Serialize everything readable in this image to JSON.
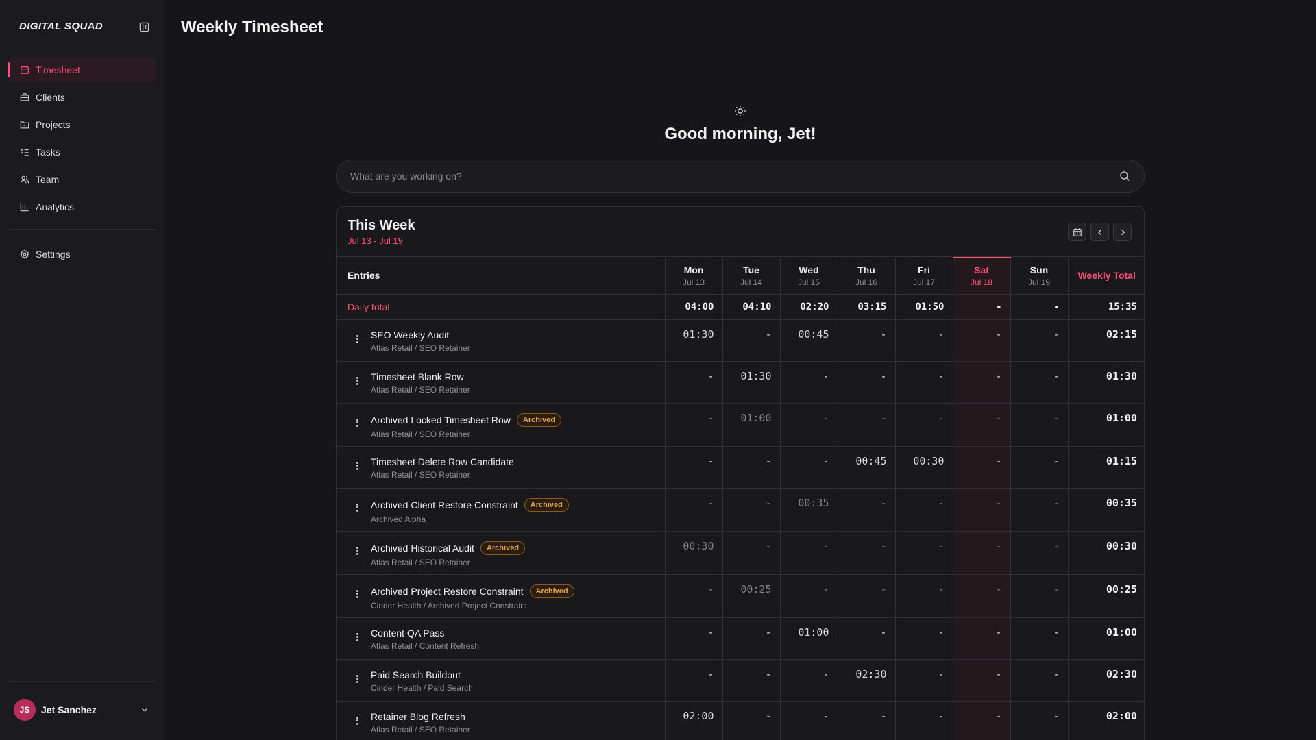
{
  "app": {
    "brand": "DIGITAL SQUAD",
    "page_title": "Weekly Timesheet",
    "accent_color": "#ff4f7a"
  },
  "sidebar": {
    "items": [
      {
        "label": "Timesheet",
        "icon": "calendar-icon",
        "active": true
      },
      {
        "label": "Clients",
        "icon": "briefcase-icon"
      },
      {
        "label": "Projects",
        "icon": "folder-icon"
      },
      {
        "label": "Tasks",
        "icon": "checklist-icon"
      },
      {
        "label": "Team",
        "icon": "users-icon"
      },
      {
        "label": "Analytics",
        "icon": "bar-chart-icon"
      }
    ],
    "settings_label": "Settings",
    "user": {
      "initials": "JS",
      "name": "Jet Sanchez"
    }
  },
  "hero": {
    "greeting": "Good morning, Jet!",
    "search_placeholder": "What are you working on?"
  },
  "week": {
    "title": "This Week",
    "range": "Jul 13 - Jul 19",
    "entries_header": "Entries",
    "total_header": "Weekly Total",
    "days": [
      {
        "name": "Mon",
        "date": "Jul 13"
      },
      {
        "name": "Tue",
        "date": "Jul 14"
      },
      {
        "name": "Wed",
        "date": "Jul 15"
      },
      {
        "name": "Thu",
        "date": "Jul 16"
      },
      {
        "name": "Fri",
        "date": "Jul 17"
      },
      {
        "name": "Sat",
        "date": "Jul 18",
        "today": true
      },
      {
        "name": "Sun",
        "date": "Jul 19"
      }
    ],
    "daily_total": {
      "label": "Daily total",
      "values": [
        "04:00",
        "04:10",
        "02:20",
        "03:15",
        "01:50",
        "-",
        "-"
      ],
      "total": "15:35"
    },
    "entries": [
      {
        "name": "SEO Weekly Audit",
        "sub": "Atlas Retail / SEO Retainer",
        "archived": false,
        "values": [
          "01:30",
          "-",
          "00:45",
          "-",
          "-",
          "-",
          "-"
        ],
        "total": "02:15"
      },
      {
        "name": "Timesheet Blank Row",
        "sub": "Atlas Retail / SEO Retainer",
        "archived": false,
        "values": [
          "-",
          "01:30",
          "-",
          "-",
          "-",
          "-",
          "-"
        ],
        "total": "01:30"
      },
      {
        "name": "Archived Locked Timesheet Row",
        "sub": "Atlas Retail / SEO Retainer",
        "archived": true,
        "values": [
          "-",
          "01:00",
          "-",
          "-",
          "-",
          "-",
          "-"
        ],
        "total": "01:00"
      },
      {
        "name": "Timesheet Delete Row Candidate",
        "sub": "Atlas Retail / SEO Retainer",
        "archived": false,
        "values": [
          "-",
          "-",
          "-",
          "00:45",
          "00:30",
          "-",
          "-"
        ],
        "total": "01:15"
      },
      {
        "name": "Archived Client Restore Constraint",
        "sub": "Archived Alpha",
        "archived": true,
        "values": [
          "-",
          "-",
          "00:35",
          "-",
          "-",
          "-",
          "-"
        ],
        "total": "00:35"
      },
      {
        "name": "Archived Historical Audit",
        "sub": "Atlas Retail / SEO Retainer",
        "archived": true,
        "values": [
          "00:30",
          "-",
          "-",
          "-",
          "-",
          "-",
          "-"
        ],
        "total": "00:30"
      },
      {
        "name": "Archived Project Restore Constraint",
        "sub": "Cinder Health / Archived Project Constraint",
        "archived": true,
        "values": [
          "-",
          "00:25",
          "-",
          "-",
          "-",
          "-",
          "-"
        ],
        "total": "00:25"
      },
      {
        "name": "Content QA Pass",
        "sub": "Atlas Retail / Content Refresh",
        "archived": false,
        "values": [
          "-",
          "-",
          "01:00",
          "-",
          "-",
          "-",
          "-"
        ],
        "total": "01:00"
      },
      {
        "name": "Paid Search Buildout",
        "sub": "Cinder Health / Paid Search",
        "archived": false,
        "values": [
          "-",
          "-",
          "-",
          "02:30",
          "-",
          "-",
          "-"
        ],
        "total": "02:30"
      },
      {
        "name": "Retainer Blog Refresh",
        "sub": "Atlas Retail / SEO Retainer",
        "archived": false,
        "values": [
          "02:00",
          "-",
          "-",
          "-",
          "-",
          "-",
          "-"
        ],
        "total": "02:00"
      }
    ],
    "archived_badge": "Archived"
  }
}
